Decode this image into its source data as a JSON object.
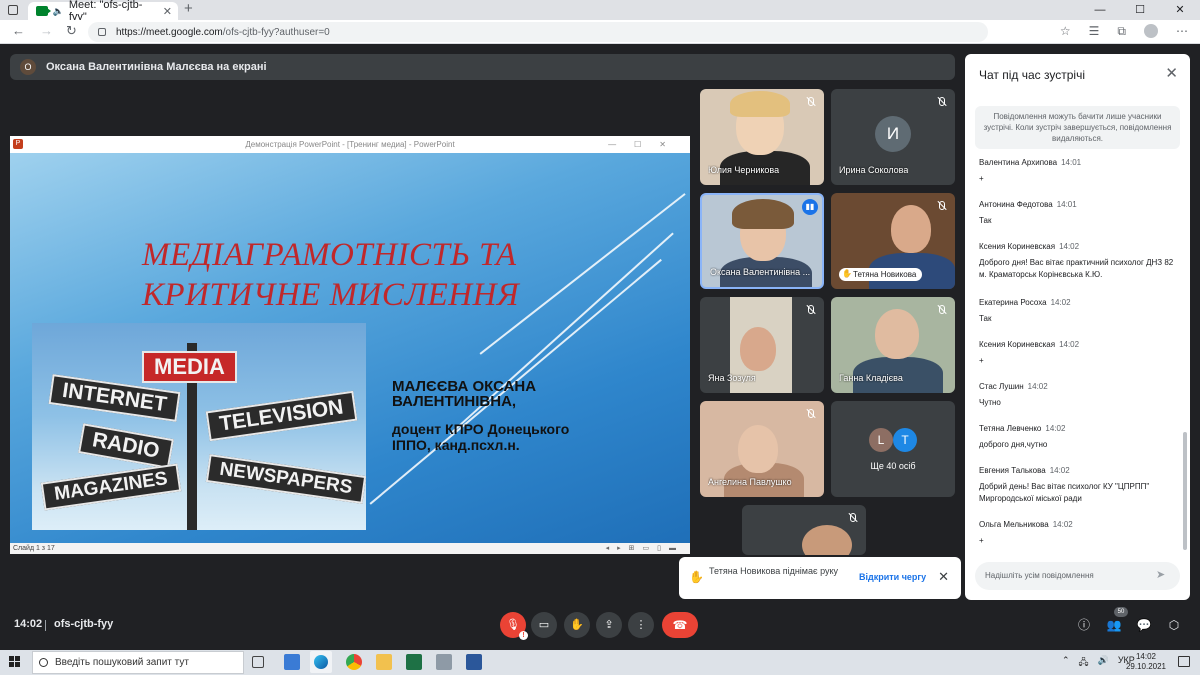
{
  "browser": {
    "tab_title": "Meet: \"ofs-cjtb-fyy\"",
    "tab_close": "✕",
    "new_tab": "+",
    "url_host": "https://meet.google.com",
    "url_path": "/ofs-cjtb-fyy?authuser=0",
    "window_controls": [
      "—",
      "☐",
      "✕"
    ]
  },
  "presenter": {
    "avatar_letter": "О",
    "text": "Оксана Валентинівна Малєєва на екрані"
  },
  "ppt": {
    "window_title": "Демонстрація PowerPoint - [Тренинг медиа] - PowerPoint",
    "slide_status": "Слайд 1 з 17",
    "slide": {
      "title_line1": "МЕДІАГРАМОТНІСТЬ ТА",
      "title_line2": "КРИТИЧНЕ МИСЛЕННЯ",
      "author_line1": "МАЛЄЄВА ОКСАНА",
      "author_line2": "ВАЛЕНТИНІВНА,",
      "affil_line1": "доцент КПРО Донецького",
      "affil_line2": "ІППО, канд.псхл.н.",
      "signs": {
        "media": "MEDIA",
        "internet": "INTERNET",
        "television": "TELEVISION",
        "radio": "RADIO",
        "magazines": "MAGAZINES",
        "newspapers": "NEWSPAPERS"
      }
    }
  },
  "tiles": [
    {
      "name": "Юлия Черникова"
    },
    {
      "name": "Ирина Соколова",
      "avatar": "И"
    },
    {
      "name": "Оксана Валентинівна ..."
    },
    {
      "name": "Тетяна Новикова"
    },
    {
      "name": "Яна Зозуля"
    },
    {
      "name": "Ганна Кладієва"
    },
    {
      "name": "Ангелина Павлушко"
    },
    {
      "name": "Ще 40 осіб",
      "avatars": [
        "L",
        "T"
      ]
    }
  ],
  "hand_notification": {
    "text": "Тетяна Новикова піднімає руку",
    "action": "Відкрити чергу",
    "close": "✕"
  },
  "chat": {
    "title": "Чат під час зустрічі",
    "close": "✕",
    "note": "Повідомлення можуть бачити лише учасники зустрічі. Коли зустріч завершується, повідомлення видаляються.",
    "messages": [
      {
        "sender": "Валентина Архипова",
        "time": "14:01",
        "text": "+"
      },
      {
        "sender": "Антонина Федотова",
        "time": "14:01",
        "text": "Так"
      },
      {
        "sender": "Ксения Кориневская",
        "time": "14:02",
        "text": "Доброго дня! Вас вітає практичний психолог ДНЗ 82 м. Краматорськ Корінєвська К.Ю."
      },
      {
        "sender": "Екатерина Росоха",
        "time": "14:02",
        "text": "Так"
      },
      {
        "sender": "Ксения Кориневская",
        "time": "14:02",
        "text": "+"
      },
      {
        "sender": "Стас Лушин",
        "time": "14:02",
        "text": "Чутно"
      },
      {
        "sender": "Тетяна Левченко",
        "time": "14:02",
        "text": "доброго дня,чутно"
      },
      {
        "sender": "Евгения Талькова",
        "time": "14:02",
        "text": "Добрий день! Вас вітає психолог КУ \"ЦПРПП\" Миргородської міської ради"
      },
      {
        "sender": "Ольга Мельникова",
        "time": "14:02",
        "text": "+"
      }
    ],
    "input_placeholder": "Надішліть усім повідомлення"
  },
  "bottom_bar": {
    "time": "14:02",
    "meeting_code": "ofs-cjtb-fyy",
    "people_count": "50",
    "mic_warning": "!"
  },
  "taskbar": {
    "search_placeholder": "Введіть пошуковий запит тут",
    "language": "УКР",
    "clock_time": "14:02",
    "clock_date": "29.10.2021"
  },
  "colors": {
    "meet_bg": "#202124",
    "tile_bg": "#3c4043",
    "accent_red": "#ea4335",
    "accent_blue": "#1a73e8",
    "slide_title_red": "#c0282b"
  }
}
